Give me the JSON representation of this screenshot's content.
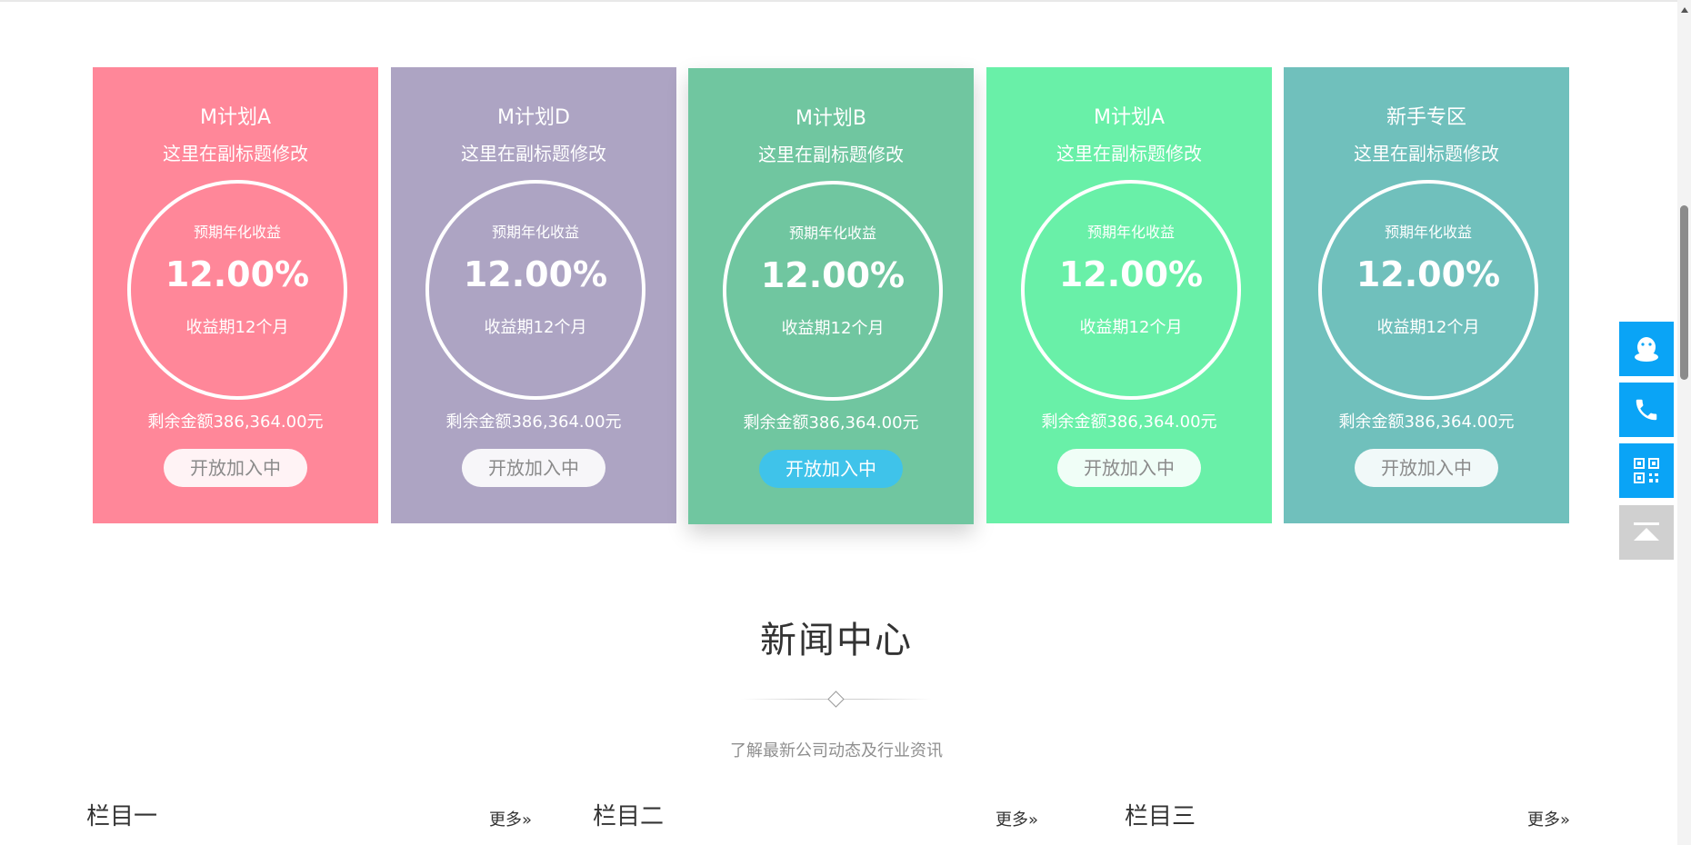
{
  "plans": [
    {
      "title": "M计划A",
      "subtitle": "这里在副标题修改",
      "rate_label": "预期年化收益",
      "rate": "12.00%",
      "term": "收益期12个月",
      "remaining": "剩余金额386,364.00元",
      "button": "开放加入中",
      "color": "#ff8799"
    },
    {
      "title": "M计划D",
      "subtitle": "这里在副标题修改",
      "rate_label": "预期年化收益",
      "rate": "12.00%",
      "term": "收益期12个月",
      "remaining": "剩余金额386,364.00元",
      "button": "开放加入中",
      "color": "#ada4c3"
    },
    {
      "title": "M计划B",
      "subtitle": "这里在副标题修改",
      "rate_label": "预期年化收益",
      "rate": "12.00%",
      "term": "收益期12个月",
      "remaining": "剩余金额386,364.00元",
      "button": "开放加入中",
      "color": "#70c6a0"
    },
    {
      "title": "M计划A",
      "subtitle": "这里在副标题修改",
      "rate_label": "预期年化收益",
      "rate": "12.00%",
      "term": "收益期12个月",
      "remaining": "剩余金额386,364.00元",
      "button": "开放加入中",
      "color": "#69f0a8"
    },
    {
      "title": "新手专区",
      "subtitle": "这里在副标题修改",
      "rate_label": "预期年化收益",
      "rate": "12.00%",
      "term": "收益期12个月",
      "remaining": "剩余金额386,364.00元",
      "button": "开放加入中",
      "color": "#70c0bc"
    }
  ],
  "news": {
    "title": "新闻中心",
    "subtitle": "了解最新公司动态及行业资讯",
    "columns": [
      {
        "title": "栏目一",
        "more": "更多»"
      },
      {
        "title": "栏目二",
        "more": "更多»"
      },
      {
        "title": "栏目三",
        "more": "更多»"
      }
    ]
  },
  "sidebar": {
    "buttons": [
      {
        "icon": "qq-penguin-icon"
      },
      {
        "icon": "phone-icon"
      },
      {
        "icon": "qr-code-icon"
      },
      {
        "icon": "back-to-top-icon"
      }
    ],
    "accent": "#0aa4f6",
    "top_button_color": "#d0d0d0"
  },
  "featured_button_color": "#3fc3ea"
}
